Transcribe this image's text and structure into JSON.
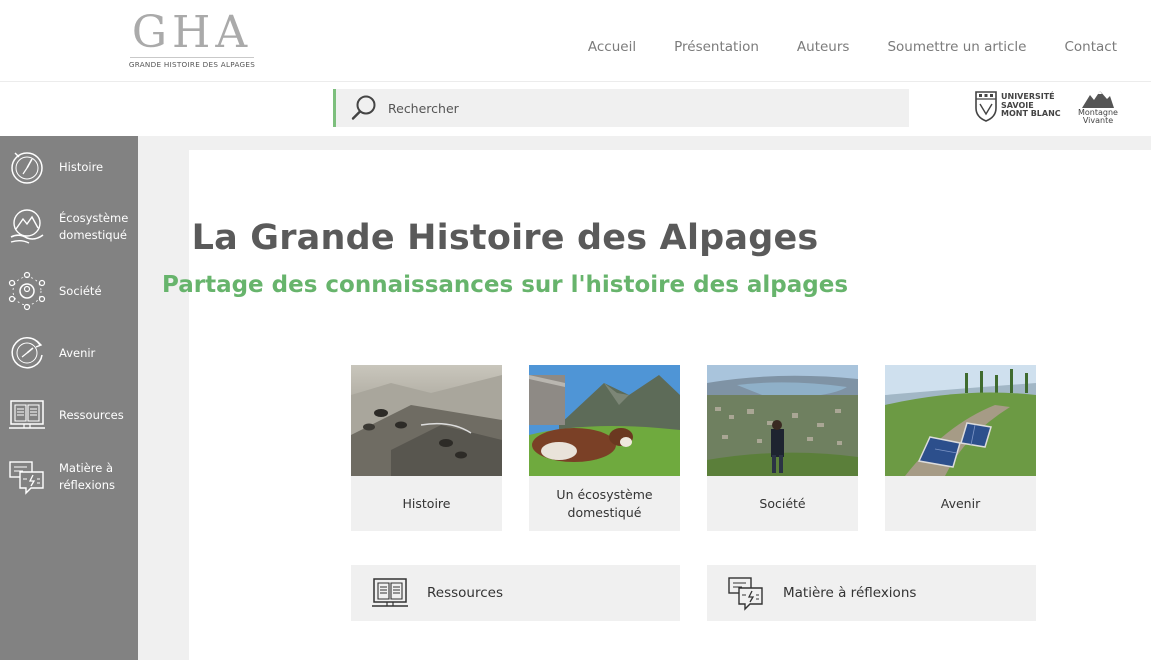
{
  "header": {
    "logo": {
      "mark": "GHA",
      "subtitle": "GRANDE HISTOIRE DES ALPAGES"
    },
    "nav": [
      {
        "label": "Accueil"
      },
      {
        "label": "Présentation"
      },
      {
        "label": "Auteurs"
      },
      {
        "label": "Soumettre un article"
      },
      {
        "label": "Contact"
      }
    ]
  },
  "search": {
    "placeholder": "Rechercher",
    "value": "",
    "icon": "search-icon"
  },
  "partners": [
    {
      "name_lines": [
        "UNIVERSITÉ",
        "SAVOIE",
        "MONT BLANC"
      ],
      "icon": "university-shield-icon"
    },
    {
      "name_lines": [
        "Montagne",
        "Vivante"
      ],
      "icon": "mountain-logo-icon"
    }
  ],
  "sidebar": {
    "items": [
      {
        "lines": [
          "Histoire"
        ],
        "icon": "compass-history-icon"
      },
      {
        "lines": [
          "Écosystème",
          "domestiqué"
        ],
        "icon": "mountain-hand-icon"
      },
      {
        "lines": [
          "Société"
        ],
        "icon": "community-network-icon"
      },
      {
        "lines": [
          "Avenir"
        ],
        "icon": "future-clock-icon"
      },
      {
        "lines": [
          "Ressources"
        ],
        "icon": "book-screen-icon"
      },
      {
        "lines": [
          "Matière à",
          "réflexions"
        ],
        "icon": "discussion-icon"
      }
    ]
  },
  "main": {
    "title": "La Grande Histoire des Alpages",
    "subtitle": "Partage des connaissances sur l'histoire des alpages",
    "cards": [
      {
        "lines": [
          "Histoire"
        ],
        "image": "historic-cows-photo"
      },
      {
        "lines": [
          "Un écosystème",
          "domestiqué"
        ],
        "image": "cow-mountain-photo"
      },
      {
        "lines": [
          "Société"
        ],
        "image": "valley-town-photo"
      },
      {
        "lines": [
          "Avenir"
        ],
        "image": "solar-panels-photo"
      }
    ],
    "wide_cards": [
      {
        "label": "Ressources",
        "icon": "book-screen-icon"
      },
      {
        "label": "Matière à réflexions",
        "icon": "discussion-icon"
      }
    ]
  },
  "colors": {
    "sidebar": "#828282",
    "accent_green": "#67b46c",
    "title": "#5a5a5a",
    "card_bg": "#f0f0f0"
  }
}
